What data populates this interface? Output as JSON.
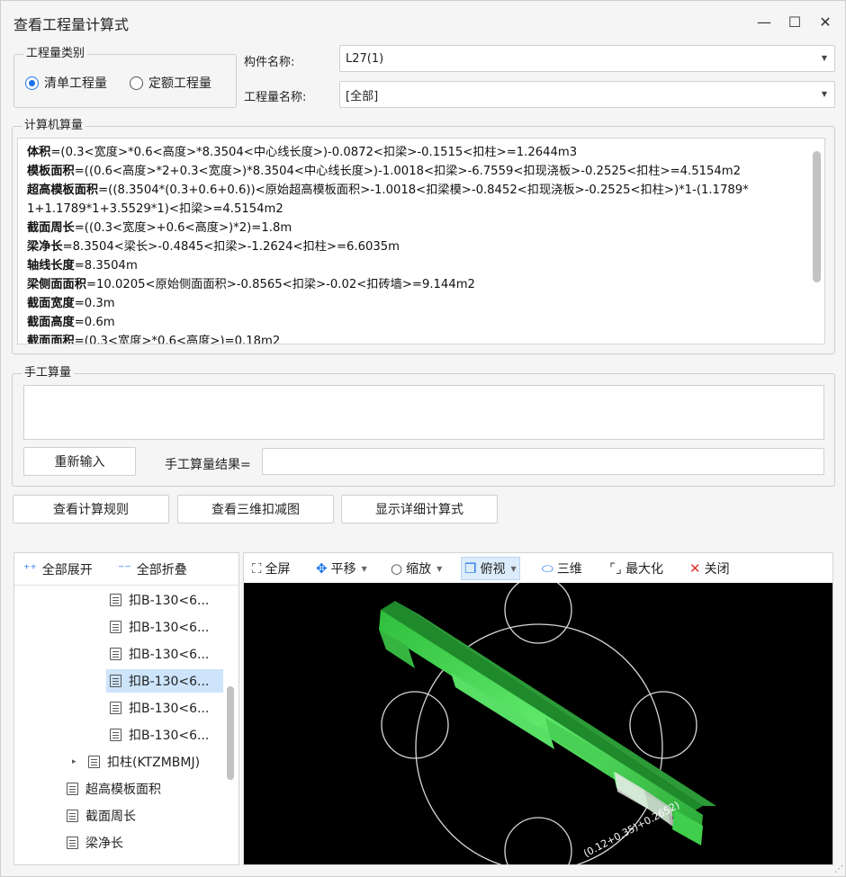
{
  "window": {
    "title": "查看工程量计算式",
    "minimize_glyph": "—",
    "maximize_glyph": "☐",
    "close_glyph": "✕"
  },
  "category": {
    "legend": "工程量类别",
    "options": [
      {
        "label": "清单工程量",
        "selected": true
      },
      {
        "label": "定额工程量",
        "selected": false
      }
    ]
  },
  "component": {
    "name_label": "构件名称:",
    "name_value": "L27(1)",
    "qty_label": "工程量名称:",
    "qty_value": "[全部]"
  },
  "computer_calc": {
    "legend": "计算机算量",
    "lines": [
      {
        "key": "体积",
        "text": "=(0.3<宽度>*0.6<高度>*8.3504<中心线长度>)-0.0872<扣梁>-0.1515<扣柱>=1.2644m3"
      },
      {
        "key": "模板面积",
        "text": "=((0.6<高度>*2+0.3<宽度>)*8.3504<中心线长度>)-1.0018<扣梁>-6.7559<扣现浇板>-0.2525<扣柱>=4.5154m2"
      },
      {
        "key": "超高模板面积",
        "text": "=((8.3504*(0.3+0.6+0.6))<原始超高模板面积>-1.0018<扣梁模>-0.8452<扣现浇板>-0.2525<扣柱>)*1-(1.1789*"
      },
      {
        "key": "",
        "text": "1+1.1789*1+3.5529*1)<扣梁>=4.5154m2"
      },
      {
        "key": "截面周长",
        "text": "=((0.3<宽度>+0.6<高度>)*2)=1.8m"
      },
      {
        "key": "梁净长",
        "text": "=8.3504<梁长>-0.4845<扣梁>-1.2624<扣柱>=6.6035m"
      },
      {
        "key": "轴线长度",
        "text": "=8.3504m"
      },
      {
        "key": "梁侧面面积",
        "text": "=10.0205<原始侧面面积>-0.8565<扣梁>-0.02<扣砖墙>=9.144m2"
      },
      {
        "key": "截面宽度",
        "text": "=0.3m"
      },
      {
        "key": "截面高度",
        "text": "=0.6m"
      },
      {
        "key": "截面面积",
        "text": "=(0.3<宽度>*0.6<高度>)=0.18m2"
      }
    ]
  },
  "manual_calc": {
    "legend": "手工算量",
    "reinput_button": "重新输入",
    "result_label": "手工算量结果=",
    "result_value": ""
  },
  "actions": {
    "view_rules": "查看计算规则",
    "view_3d": "查看三维扣减图",
    "show_detail": "显示详细计算式"
  },
  "tree": {
    "expand_all": "全部展开",
    "collapse_all": "全部折叠",
    "items": [
      {
        "label": "扣B-130<6...",
        "level": 2,
        "selected": false
      },
      {
        "label": "扣B-130<6...",
        "level": 2,
        "selected": false
      },
      {
        "label": "扣B-130<6...",
        "level": 2,
        "selected": false
      },
      {
        "label": "扣B-130<6...",
        "level": 2,
        "selected": true
      },
      {
        "label": "扣B-130<6...",
        "level": 2,
        "selected": false
      },
      {
        "label": "扣B-130<6...",
        "level": 2,
        "selected": false
      },
      {
        "label": "扣柱(KTZMBMJ)",
        "level": 1,
        "selected": false,
        "expander": "▸"
      },
      {
        "label": "超高模板面积",
        "level": 0,
        "selected": false
      },
      {
        "label": "截面周长",
        "level": 0,
        "selected": false
      },
      {
        "label": "梁净长",
        "level": 0,
        "selected": false
      }
    ]
  },
  "viewer": {
    "tools": [
      {
        "label": "全屏",
        "icon": "fullscreen-icon",
        "dropdown": false,
        "selected": false
      },
      {
        "label": "平移",
        "icon": "pan-icon",
        "dropdown": true,
        "selected": false
      },
      {
        "label": "缩放",
        "icon": "zoom-icon",
        "dropdown": true,
        "selected": false
      },
      {
        "label": "俯视",
        "icon": "top-view-icon",
        "dropdown": true,
        "selected": true
      },
      {
        "label": "三维",
        "icon": "3d-view-icon",
        "dropdown": false,
        "selected": false
      },
      {
        "label": "最大化",
        "icon": "maximize-icon",
        "dropdown": false,
        "selected": false
      },
      {
        "label": "关闭",
        "icon": "close-icon",
        "dropdown": false,
        "selected": false
      }
    ],
    "annotation": "(0.12+0.35)+0.2652)",
    "colors": {
      "beam": "#3ddc4a",
      "background": "#000000",
      "circles": "#d8d8d8",
      "accent": "#1a73e8"
    }
  }
}
